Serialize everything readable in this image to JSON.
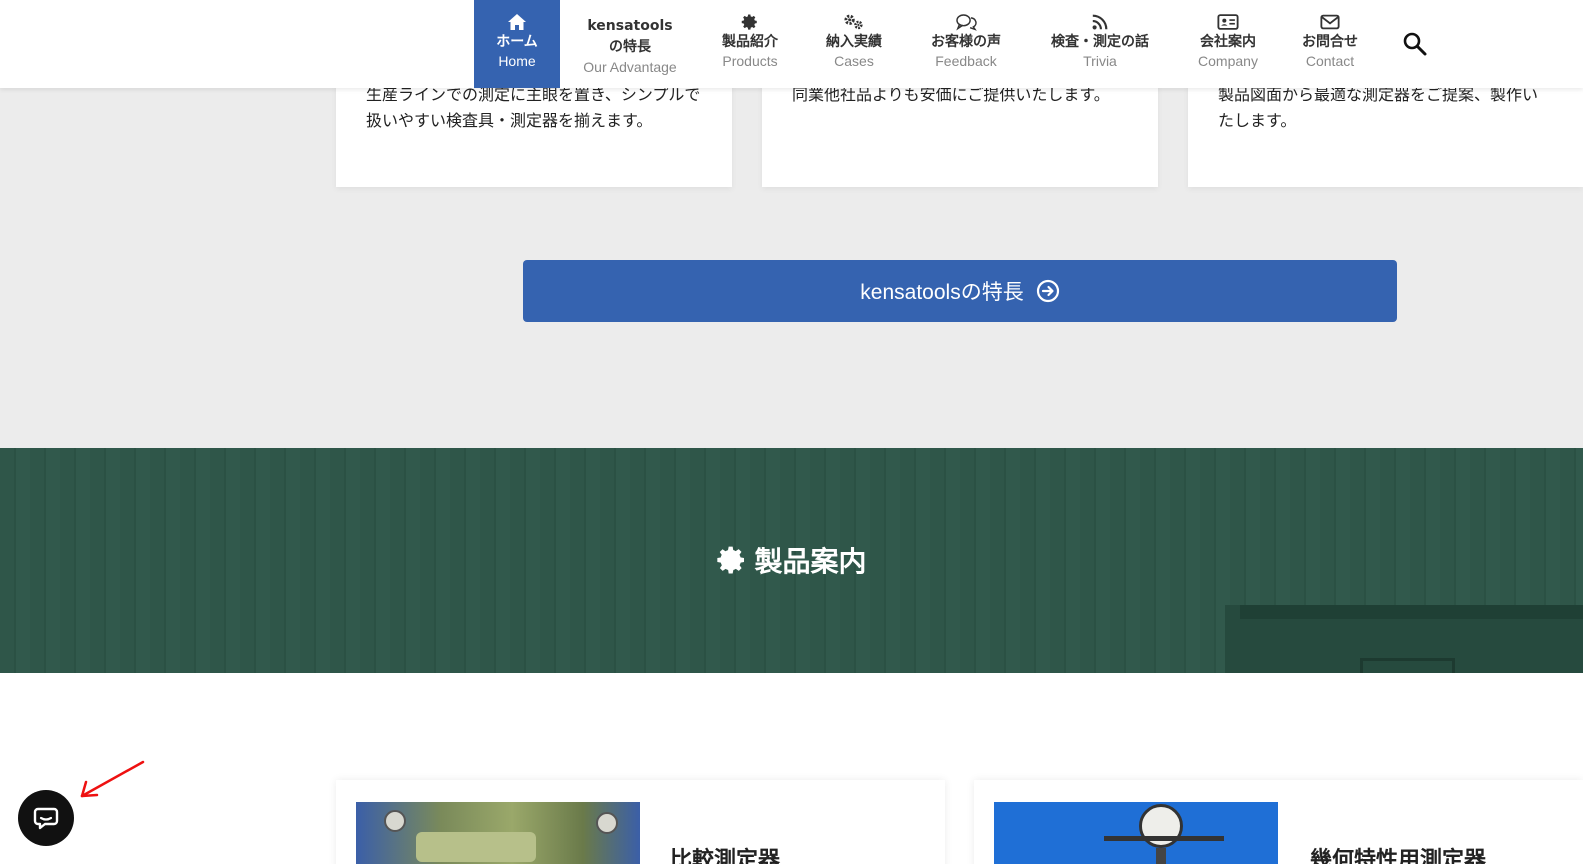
{
  "nav": {
    "items": [
      {
        "jp": "ホーム",
        "en": "Home",
        "icon": "home-icon"
      },
      {
        "jp1": "kensatools",
        "jp2": "の特長",
        "en": "Our Advantage"
      },
      {
        "jp": "製品紹介",
        "en": "Products",
        "icon": "gear-icon"
      },
      {
        "jp": "納入実績",
        "en": "Cases",
        "icon": "gears-icon"
      },
      {
        "jp": "お客様の声",
        "en": "Feedback",
        "icon": "chat-bubbles-icon"
      },
      {
        "jp": "検査・測定の話",
        "en": "Trivia",
        "icon": "rss-icon"
      },
      {
        "jp": "会社案内",
        "en": "Company",
        "icon": "id-card-icon"
      },
      {
        "jp": "お問合せ",
        "en": "Contact",
        "icon": "envelope-icon"
      }
    ]
  },
  "features": [
    {
      "text": "生産ラインでの測定に主眼を置き、シンプルで扱いやすい検査具・測定器を揃えます。"
    },
    {
      "text": "同業他社品よりも安価にご提供いたします。"
    },
    {
      "text": "製品図面から最適な測定器をご提案、製作いたします。"
    }
  ],
  "cta": {
    "label": "kensatoolsの特長"
  },
  "products_section": {
    "title": "製品案内"
  },
  "products": [
    {
      "title": "比較測定器"
    },
    {
      "title": "幾何特性用測定器"
    }
  ],
  "colors": {
    "accent": "#3563b0",
    "band": "#2f5649"
  }
}
